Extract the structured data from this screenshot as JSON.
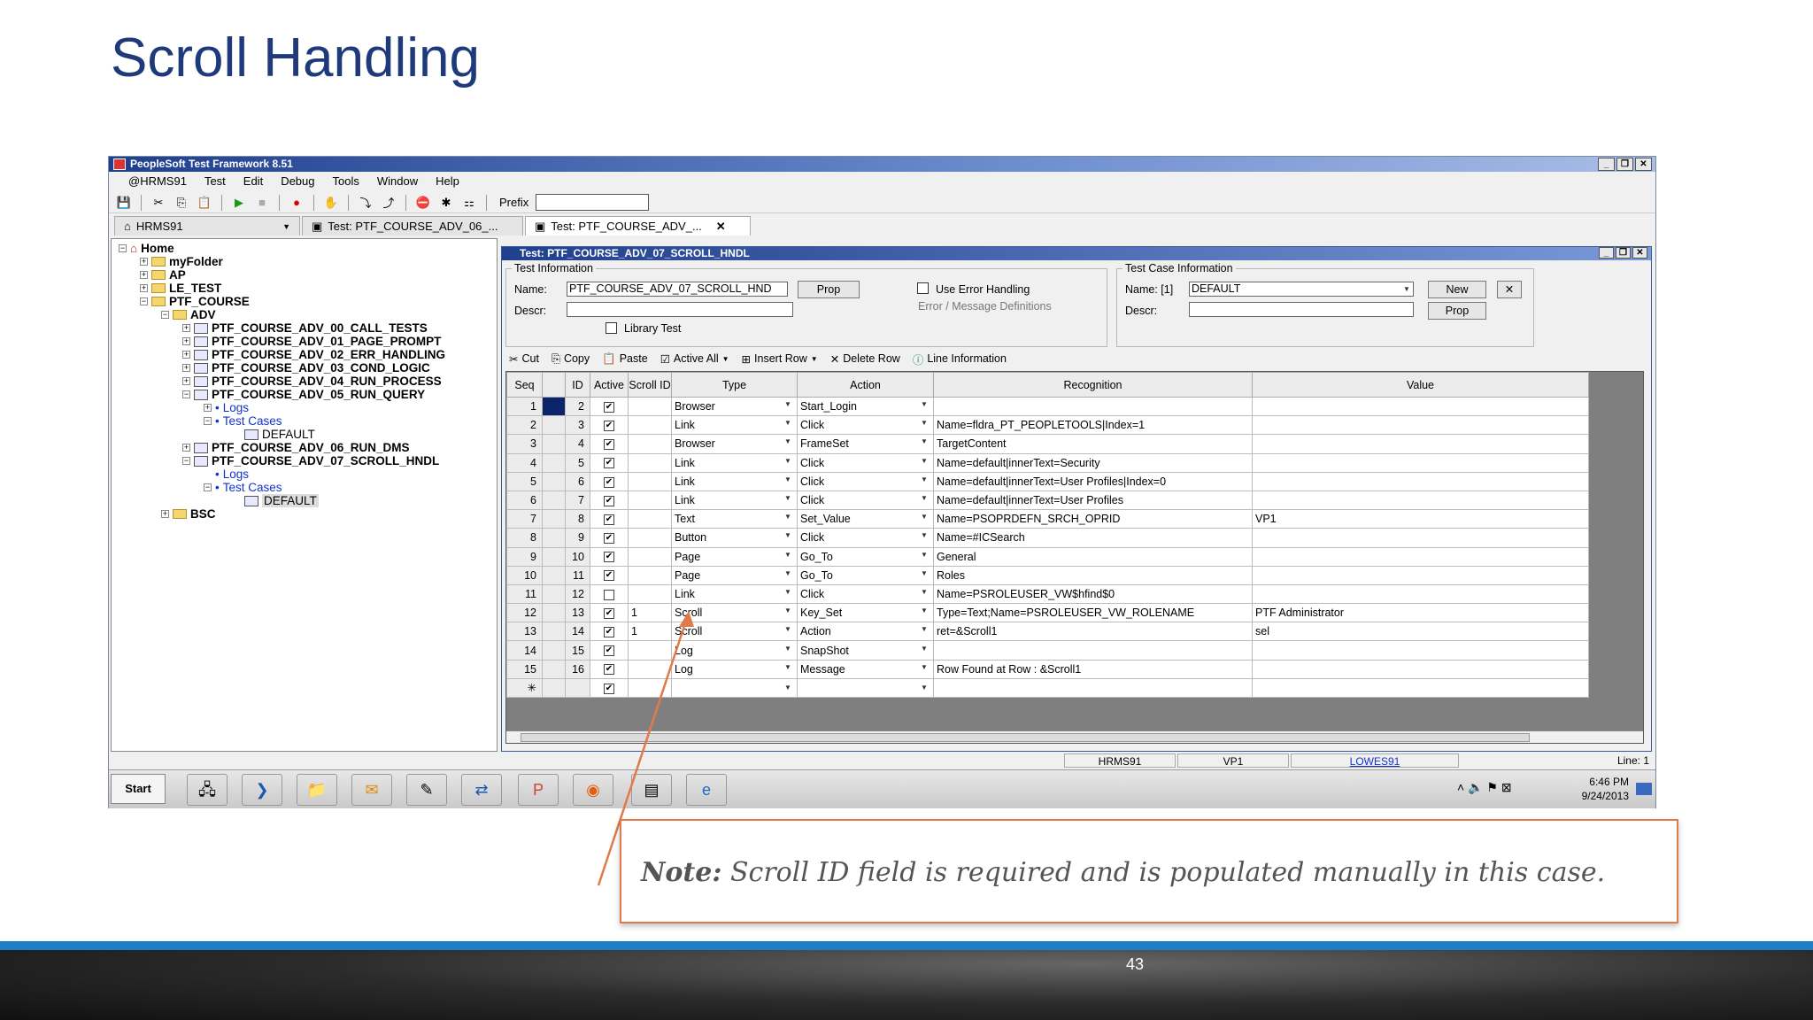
{
  "slide": {
    "title": "Scroll Handling",
    "page_number": "43",
    "note_label": "Note:",
    "note_text": " Scroll ID field is required and is populated manually in this case."
  },
  "window": {
    "title": "PeopleSoft Test Framework 8.51",
    "menus": [
      "@HRMS91",
      "Test",
      "Edit",
      "Debug",
      "Tools",
      "Window",
      "Help"
    ],
    "prefix_label": "Prefix",
    "tabs": [
      "HRMS91",
      "Test: PTF_COURSE_ADV_06_...",
      "Test: PTF_COURSE_ADV_..."
    ]
  },
  "tree": {
    "items": [
      "Home",
      "myFolder",
      "AP",
      "LE_TEST",
      "PTF_COURSE",
      "ADV",
      "PTF_COURSE_ADV_00_CALL_TESTS",
      "PTF_COURSE_ADV_01_PAGE_PROMPT",
      "PTF_COURSE_ADV_02_ERR_HANDLING",
      "PTF_COURSE_ADV_03_COND_LOGIC",
      "PTF_COURSE_ADV_04_RUN_PROCESS",
      "PTF_COURSE_ADV_05_RUN_QUERY",
      "Logs",
      "Test Cases",
      "DEFAULT",
      "PTF_COURSE_ADV_06_RUN_DMS",
      "PTF_COURSE_ADV_07_SCROLL_HNDL",
      "Logs",
      "Test Cases",
      "DEFAULT",
      "BSC"
    ]
  },
  "test": {
    "title": "Test: PTF_COURSE_ADV_07_SCROLL_HNDL",
    "info_legend": "Test Information",
    "name_label": "Name:",
    "name_value": "PTF_COURSE_ADV_07_SCROLL_HND",
    "prop_label": "Prop",
    "descr_label": "Descr:",
    "library_label": "Library Test",
    "use_error_label": "Use Error Handling",
    "error_defs_label": "Error / Message Definitions",
    "case_legend": "Test Case Information",
    "case_name_label": "Name: [1]",
    "case_name_value": "DEFAULT",
    "new_label": "New",
    "case_prop_label": "Prop",
    "case_descr_label": "Descr:"
  },
  "grid_toolbar": [
    "Cut",
    "Copy",
    "Paste",
    "Active All",
    "Insert Row",
    "Delete Row",
    "Line Information"
  ],
  "grid": {
    "headers": [
      "Seq",
      "ID",
      "Active",
      "Scroll ID",
      "Type",
      "Action",
      "Recognition",
      "Value"
    ],
    "rows": [
      [
        "1",
        "2",
        "✔",
        "",
        "Browser",
        "Start_Login",
        "",
        ""
      ],
      [
        "2",
        "3",
        "✔",
        "",
        "Link",
        "Click",
        "Name=fldra_PT_PEOPLETOOLS|Index=1",
        ""
      ],
      [
        "3",
        "4",
        "✔",
        "",
        "Browser",
        "FrameSet",
        "TargetContent",
        ""
      ],
      [
        "4",
        "5",
        "✔",
        "",
        "Link",
        "Click",
        "Name=default|innerText=Security",
        ""
      ],
      [
        "5",
        "6",
        "✔",
        "",
        "Link",
        "Click",
        "Name=default|innerText=User Profiles|Index=0",
        ""
      ],
      [
        "6",
        "7",
        "✔",
        "",
        "Link",
        "Click",
        "Name=default|innerText=User Profiles",
        ""
      ],
      [
        "7",
        "8",
        "✔",
        "",
        "Text",
        "Set_Value",
        "Name=PSOPRDEFN_SRCH_OPRID",
        "VP1"
      ],
      [
        "8",
        "9",
        "✔",
        "",
        "Button",
        "Click",
        "Name=#ICSearch",
        ""
      ],
      [
        "9",
        "10",
        "✔",
        "",
        "Page",
        "Go_To",
        "General",
        ""
      ],
      [
        "10",
        "11",
        "✔",
        "",
        "Page",
        "Go_To",
        "Roles",
        ""
      ],
      [
        "11",
        "12",
        "",
        "",
        "Link",
        "Click",
        "Name=PSROLEUSER_VW$hfind$0",
        ""
      ],
      [
        "12",
        "13",
        "✔",
        "1",
        "Scroll",
        "Key_Set",
        "Type=Text;Name=PSROLEUSER_VW_ROLENAME",
        "PTF Administrator"
      ],
      [
        "13",
        "14",
        "✔",
        "1",
        "Scroll",
        "Action",
        "ret=&Scroll1",
        "sel"
      ],
      [
        "14",
        "15",
        "✔",
        "",
        "Log",
        "SnapShot",
        "",
        ""
      ],
      [
        "15",
        "16",
        "✔",
        "",
        "Log",
        "Message",
        "Row Found at Row : &Scroll1",
        ""
      ],
      [
        "✳",
        "",
        "✔",
        "",
        "",
        "",
        "",
        ""
      ]
    ]
  },
  "status": {
    "db": "HRMS91",
    "user": "VP1",
    "server": "LOWES91",
    "line": "Line: 1"
  },
  "taskbar": {
    "start": "Start",
    "time": "6:46 PM",
    "date": "9/24/2013"
  }
}
